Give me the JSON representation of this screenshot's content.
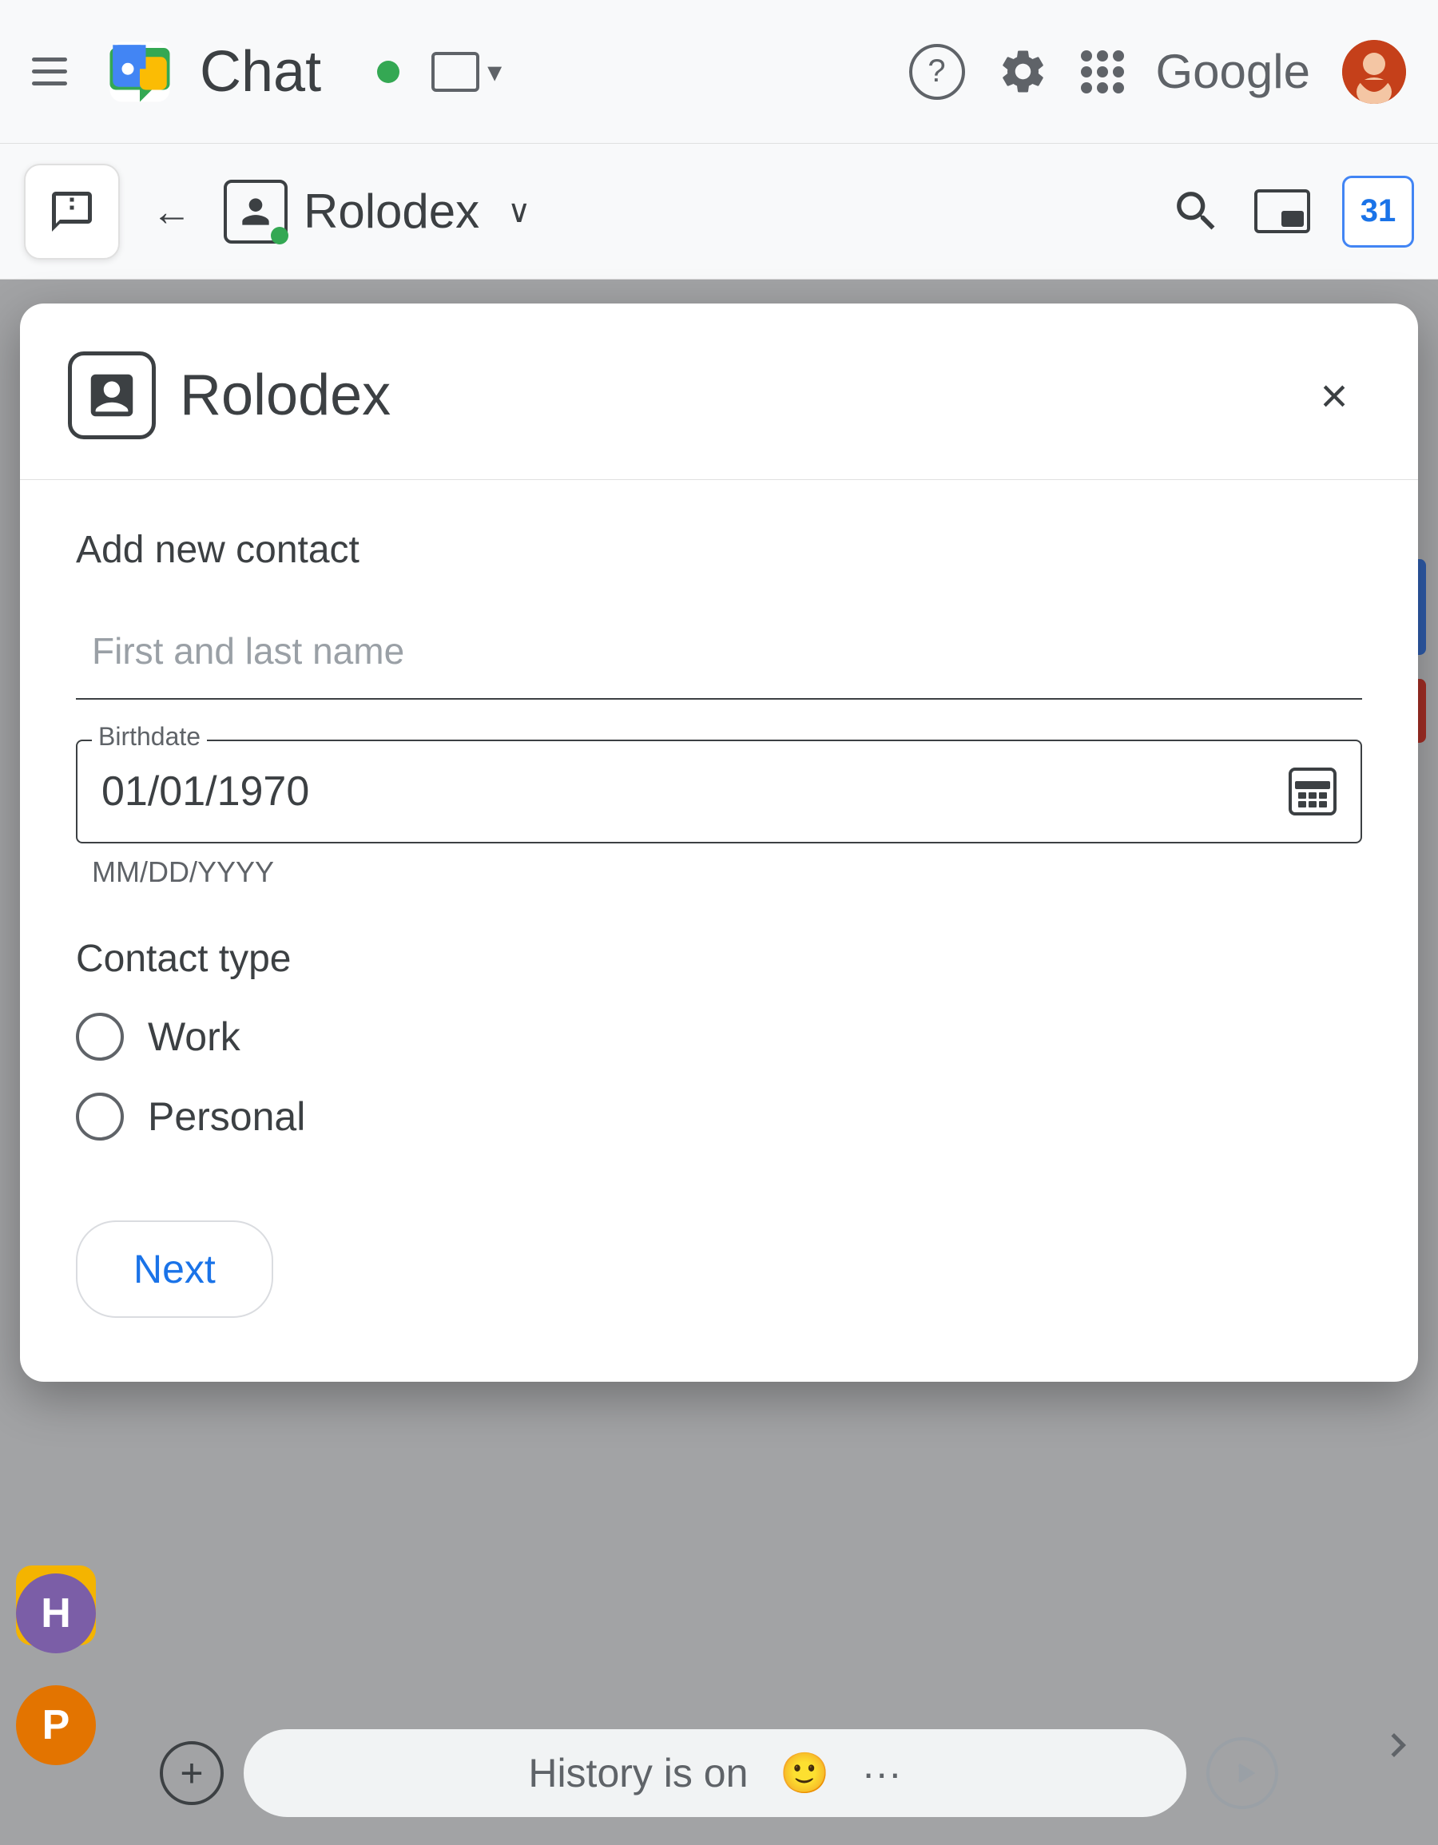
{
  "app": {
    "title": "Chat",
    "status": "online"
  },
  "topbar": {
    "chat_label": "Chat",
    "google_label": "Google",
    "window_dropdown_visible": true
  },
  "subbar": {
    "back_label": "←",
    "page_name": "Rolodex",
    "dropdown_arrow": "∨"
  },
  "modal": {
    "title": "Rolodex",
    "close_label": "×",
    "form": {
      "section_label": "Add new contact",
      "name_placeholder": "First and last name",
      "birthdate_label": "Birthdate",
      "birthdate_value": "01/01/1970",
      "birthdate_format": "MM/DD/YYYY",
      "contact_type_label": "Contact type",
      "options": [
        {
          "id": "work",
          "label": "Work",
          "checked": false
        },
        {
          "id": "personal",
          "label": "Personal",
          "checked": false
        }
      ],
      "next_button": "Next"
    }
  },
  "chat_bar": {
    "history_text": "History is on",
    "plus_label": "+",
    "emoji_label": "🙂",
    "more_label": "···",
    "send_label": "▷"
  },
  "sidebar": {
    "avatars": [
      {
        "letter": "H",
        "color": "#7b5ea7"
      },
      {
        "letter": "P",
        "color": "#e37400"
      }
    ]
  },
  "colors": {
    "accent_blue": "#1a73e8",
    "text_primary": "#3c4043",
    "text_secondary": "#5f6368",
    "border": "#dadce0",
    "online_green": "#34a853"
  }
}
